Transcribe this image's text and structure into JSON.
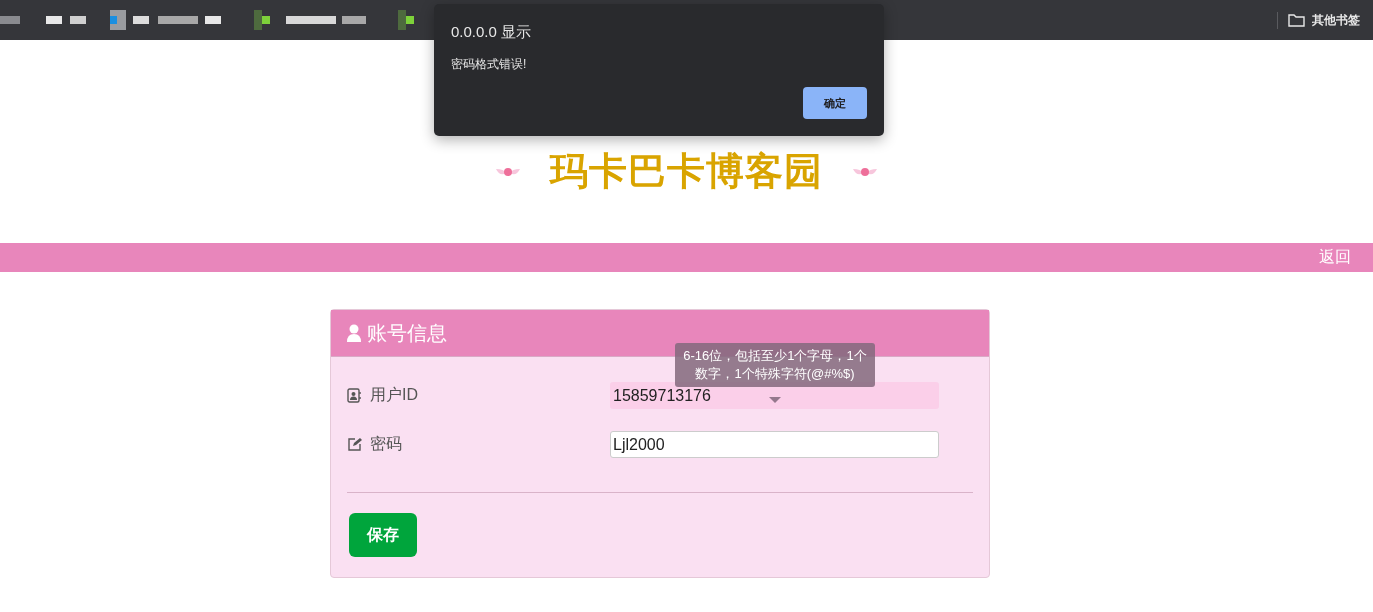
{
  "bookmarks_bar": {
    "other_bookmarks": "其他书签"
  },
  "dialog": {
    "title": "0.0.0.0 显示",
    "message": "密码格式错误!",
    "confirm": "确定"
  },
  "site_title": "玛卡巴卡博客园",
  "nav": {
    "back": "返回"
  },
  "card": {
    "title": "账号信息",
    "fields": [
      {
        "kind": "readonly",
        "label": "用户ID",
        "value": "15859713176"
      },
      {
        "kind": "text",
        "label": "密码",
        "value": "Ljl2000"
      }
    ],
    "tooltip": "6-16位，包括至少1个字母，1个数字，1个特殊字符(@#%$)",
    "save": "保存"
  }
}
